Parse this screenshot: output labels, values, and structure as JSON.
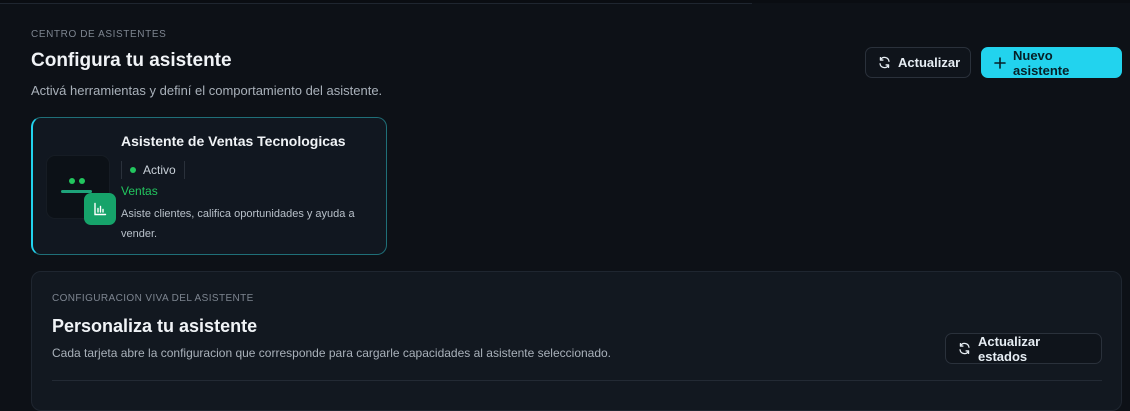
{
  "header": {
    "kicker": "CENTRO DE ASISTENTES",
    "title": "Configura tu asistente",
    "subtitle": "Activá herramientas y definí el comportamiento del asistente.",
    "refresh_label": "Actualizar",
    "new_label": "Nuevo asistente"
  },
  "assistants": [
    {
      "name": "Asistente de Ventas Tecnologicas",
      "status": "Activo",
      "category": "Ventas",
      "description": "Asiste clientes, califica oportunidades y ayuda a vender.",
      "category_icon": "bar-chart-icon"
    }
  ],
  "config": {
    "kicker": "CONFIGURACION VIVA DEL ASISTENTE",
    "title": "Personaliza tu asistente",
    "description": "Cada tarjeta abre la configuracion que corresponde para cargarle capacidades al asistente seleccionado.",
    "refresh_states_label": "Actualizar estados"
  },
  "colors": {
    "accent": "#22d3ee",
    "success": "#22c55e",
    "background": "#0d1117"
  }
}
